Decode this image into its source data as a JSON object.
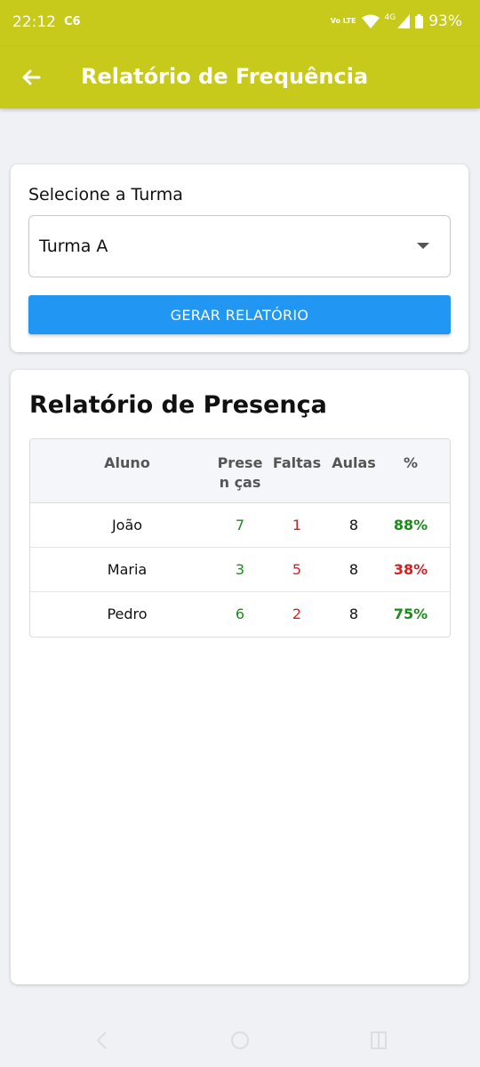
{
  "status": {
    "time": "22:12",
    "carrier": "C6",
    "volte": "Vo LTE",
    "network": "4G",
    "battery": "93%"
  },
  "appbar": {
    "title": "Relatório de Frequência"
  },
  "selector": {
    "label": "Selecione a Turma",
    "value": "Turma A",
    "button": "GERAR RELATÓRIO"
  },
  "report": {
    "title": "Relatório de Presença",
    "headers": {
      "aluno": "Aluno",
      "presencas": "Presen ças",
      "faltas": "Faltas",
      "aulas": "Aulas",
      "pct": "%"
    },
    "rows": [
      {
        "aluno": "João",
        "presencas": "7",
        "faltas": "1",
        "aulas": "8",
        "pct": "88%",
        "pct_color": "#1a8c1a"
      },
      {
        "aluno": "Maria",
        "presencas": "3",
        "faltas": "5",
        "aulas": "8",
        "pct": "38%",
        "pct_color": "#d62020"
      },
      {
        "aluno": "Pedro",
        "presencas": "6",
        "faltas": "2",
        "aulas": "8",
        "pct": "75%",
        "pct_color": "#1a8c1a"
      }
    ]
  },
  "colors": {
    "appbar": "#c7c91b",
    "button": "#2196f3",
    "present": "#1a8c1a",
    "absent": "#d62020"
  }
}
